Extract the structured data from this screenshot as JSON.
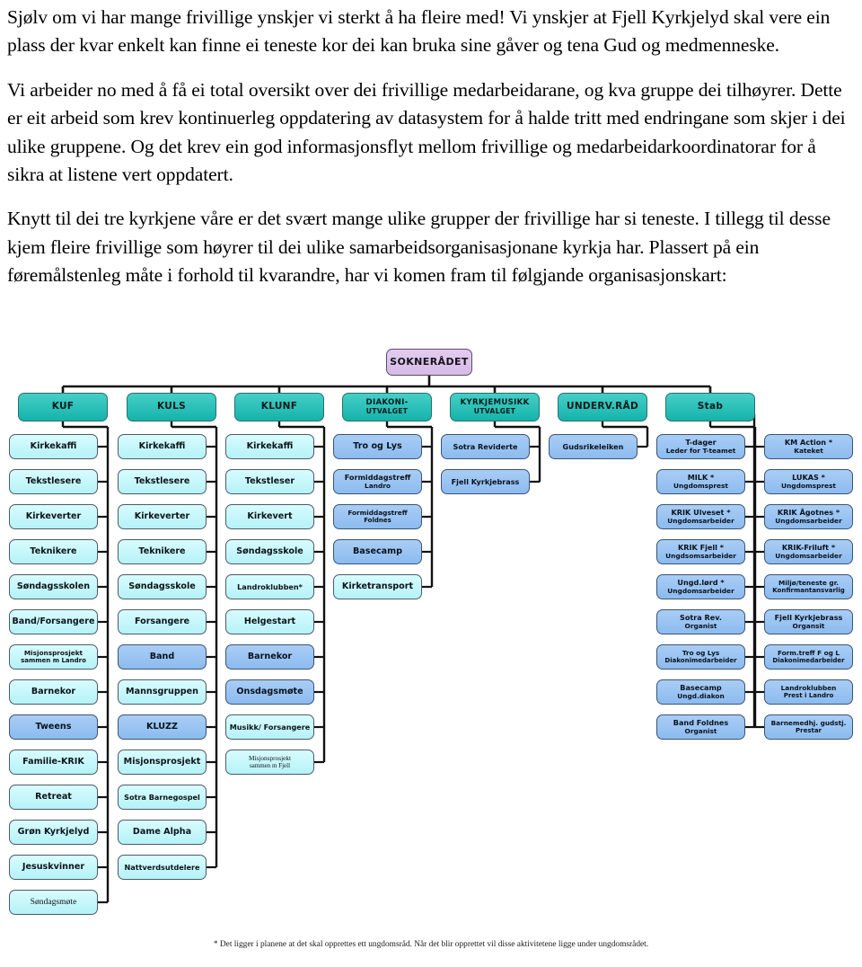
{
  "document": {
    "paragraphs": [
      "Sjølv om vi har mange frivillige ynskjer vi sterkt å ha fleire med! Vi ynskjer at Fjell Kyrkjelyd skal vere ein plass der kvar enkelt kan finne ei teneste kor dei kan bruka sine gåver og tena Gud og medmenneske.",
      "Vi arbeider no med å få ei total oversikt over dei frivillige medarbeidarane, og kva gruppe dei tilhøyrer. Dette er eit arbeid som krev kontinuerleg oppdatering av datasystem for å halde tritt med endringane som skjer i dei ulike gruppene. Og det krev ein god informasjonsflyt mellom frivillige og medarbeidarkoordinatorar for å sikra at listene vert oppdatert.",
      "Knytt til dei tre kyrkjene våre er det svært mange ulike grupper der frivillige har si teneste. I tillegg til desse kjem fleire frivillige som høyrer til dei ulike samarbeidsorganisasjonane kyrkja har. Plassert på ein føremålstenleg måte i forhold til kvarandre, har vi komen fram til følgjande organisasjonskart:"
    ],
    "footnote": "* Det ligger i planene at det skal opprettes ett ungdomsråd. Når det blir opprettet vil disse aktivitetene ligge under ungdomsrådet."
  },
  "chart_data": {
    "type": "diagram",
    "title": "Organisasjonskart",
    "colors": {
      "root": "#d5bbe6",
      "level1": "#15b3ab",
      "leaf_cyan": "#b5f2f7",
      "leaf_blue": "#8cbbef",
      "connector": "#111111"
    },
    "root": {
      "label": "SOKNERÅDET"
    },
    "columns": [
      {
        "header": "KUF",
        "children": [
          {
            "l1": "Kirkekaffi",
            "color": "cyan"
          },
          {
            "l1": "Tekstlesere",
            "color": "cyan"
          },
          {
            "l1": "Kirkeverter",
            "color": "cyan"
          },
          {
            "l1": "Teknikere",
            "color": "cyan"
          },
          {
            "l1": "Søndagsskolen",
            "color": "cyan"
          },
          {
            "l1": "Band/Forsangere",
            "color": "cyan"
          },
          {
            "l1": "Misjonsprosjekt",
            "l2": "sammen m Landro",
            "color": "cyan",
            "size": "xs"
          },
          {
            "l1": "Barnekor",
            "color": "cyan"
          },
          {
            "l1": "Tweens",
            "color": "blue"
          },
          {
            "l1": "Familie-KRIK",
            "color": "cyan"
          },
          {
            "l1": "Retreat",
            "color": "cyan"
          },
          {
            "l1": "Grøn Kyrkjelyd",
            "color": "cyan"
          },
          {
            "l1": "Jesuskvinner",
            "color": "cyan"
          },
          {
            "l1": "Søndagsmøte",
            "color": "cyan",
            "serif": true
          }
        ]
      },
      {
        "header": "KULS",
        "children": [
          {
            "l1": "Kirkekaffi",
            "color": "cyan"
          },
          {
            "l1": "Tekstlesere",
            "color": "cyan"
          },
          {
            "l1": "Kirkeverter",
            "color": "cyan"
          },
          {
            "l1": "Teknikere",
            "color": "cyan"
          },
          {
            "l1": "Søndagsskole",
            "color": "cyan"
          },
          {
            "l1": "Forsangere",
            "color": "cyan"
          },
          {
            "l1": "Band",
            "color": "blue"
          },
          {
            "l1": "Mannsgruppen",
            "color": "cyan"
          },
          {
            "l1": "KLUZZ",
            "color": "blue"
          },
          {
            "l1": "Misjonsprosjekt",
            "color": "cyan"
          },
          {
            "l1": "Sotra Barnegospel",
            "color": "cyan",
            "size": "sm"
          },
          {
            "l1": "Dame Alpha",
            "color": "cyan"
          },
          {
            "l1": "Nattverdsutdelere",
            "color": "cyan",
            "size": "sm"
          }
        ]
      },
      {
        "header": "KLUNF",
        "children": [
          {
            "l1": "Kirkekaffi",
            "color": "cyan"
          },
          {
            "l1": "Tekstleser",
            "color": "cyan"
          },
          {
            "l1": "Kirkevert",
            "color": "cyan"
          },
          {
            "l1": "Søndagsskole",
            "color": "cyan"
          },
          {
            "l1": "Landroklubben*",
            "color": "cyan",
            "size": "sm"
          },
          {
            "l1": "Helgestart",
            "color": "cyan"
          },
          {
            "l1": "Barnekor",
            "color": "blue"
          },
          {
            "l1": "Onsdagsmøte",
            "color": "blue"
          },
          {
            "l1": "Musikk/ Forsangere",
            "color": "cyan",
            "size": "sm"
          },
          {
            "l1": "Misjonsprosjekt",
            "l2": "sammen m Fjell",
            "color": "cyan",
            "size": "xs",
            "serif": true
          }
        ]
      },
      {
        "header": "DIAKONI-",
        "header2": "UTVALGET",
        "children": [
          {
            "l1": "Tro og Lys",
            "color": "blue"
          },
          {
            "l1": "Formiddagstreff",
            "l2": "Landro",
            "color": "blue",
            "size": "sm"
          },
          {
            "l1": "Formiddagstreff",
            "l2": "Foldnes",
            "color": "blue",
            "size": "xs"
          },
          {
            "l1": "Basecamp",
            "color": "blue"
          },
          {
            "l1": "Kirketransport",
            "color": "cyan"
          }
        ]
      },
      {
        "header": "KYRKJEMUSIKK",
        "header2": "UTVALGET",
        "children": [
          {
            "l1": "Sotra Reviderte",
            "color": "blue",
            "size": "sm"
          },
          {
            "l1": "Fjell Kyrkjebrass",
            "color": "blue",
            "size": "sm"
          }
        ]
      },
      {
        "header": "UNDERV.RÅD",
        "children": [
          {
            "l1": "Gudsrikeleiken",
            "color": "blue",
            "size": "sm"
          }
        ]
      },
      {
        "header": "Stab",
        "children": [
          {
            "l1": "T-dager",
            "l2": "Leder for T-teamet",
            "color": "blue",
            "size": "sm"
          },
          {
            "l1": "MILK *",
            "l2": "Ungdomsprest",
            "color": "blue",
            "size": "sm"
          },
          {
            "l1": "KRIK Ulveset *",
            "l2": "Ungdomsarbeider",
            "color": "blue",
            "size": "sm"
          },
          {
            "l1": "KRIK Fjell *",
            "l2": "Ungdsomsarbeider",
            "color": "blue",
            "size": "sm"
          },
          {
            "l1": "Ungd.lørd *",
            "l2": "Ungdomsarbeider",
            "color": "blue",
            "size": "sm"
          },
          {
            "l1": "Sotra Rev.",
            "l2": "Organist",
            "color": "blue",
            "size": "sm"
          },
          {
            "l1": "Tro og Lys",
            "l2": "Diakonimedarbeider",
            "color": "blue",
            "size": "xs"
          },
          {
            "l1": "Basecamp",
            "l2": "Ungd.diakon",
            "color": "blue",
            "size": "sm"
          },
          {
            "l1": "Band Foldnes",
            "l2": "Organist",
            "color": "blue",
            "size": "sm"
          }
        ]
      },
      {
        "header": "",
        "children": [
          {
            "l1": "KM Action *",
            "l2": "Kateket",
            "color": "blue",
            "size": "sm"
          },
          {
            "l1": "LUKAS *",
            "l2": "Ungdomsprest",
            "color": "blue",
            "size": "sm"
          },
          {
            "l1": "KRIK Ågotnes *",
            "l2": "Ungdomsarbeider",
            "color": "blue",
            "size": "sm"
          },
          {
            "l1": "KRIK-Friluft *",
            "l2": "Ungdomsarbeider",
            "color": "blue",
            "size": "sm"
          },
          {
            "l1": "Miljø/teneste gr.",
            "l2": "Konfirmantansvarlig",
            "color": "blue",
            "size": "xs"
          },
          {
            "l1": "Fjell Kyrkjebrass",
            "l2": "Organsit",
            "color": "blue",
            "size": "sm"
          },
          {
            "l1": "Form.treff  F og L",
            "l2": "Diakonimedarbeider",
            "color": "blue",
            "size": "xs"
          },
          {
            "l1": "Landroklubben",
            "l2": "Prest i Landro",
            "color": "blue",
            "size": "xs"
          },
          {
            "l1": "Barnemedhj. gudstj.",
            "l2": "Prestar",
            "color": "blue",
            "size": "xs"
          }
        ]
      }
    ]
  }
}
